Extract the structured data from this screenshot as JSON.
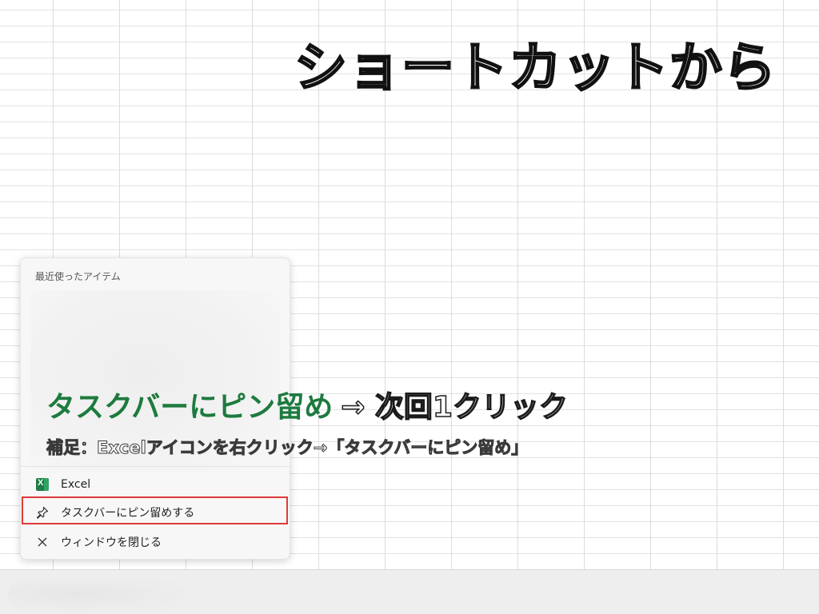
{
  "headline": "ショートカットから",
  "jumplist": {
    "recent_header": "最近使ったアイテム",
    "items": [
      {
        "label": "Excel",
        "icon": "excel-icon"
      },
      {
        "label": "タスクバーにピン留めする",
        "icon": "pin-icon"
      },
      {
        "label": "ウィンドウを閉じる",
        "icon": "close-icon"
      }
    ]
  },
  "caption": {
    "main_green": "タスクバーにピン留め",
    "main_arrow": "→ 次回1クリック",
    "sub": "補足：Excelアイコンを右クリック→「タスクバーにピン留め」"
  },
  "colors": {
    "highlight": "#e03a3a",
    "caption_green": "#1d7a3e",
    "excel_green": "#1e7b45"
  }
}
